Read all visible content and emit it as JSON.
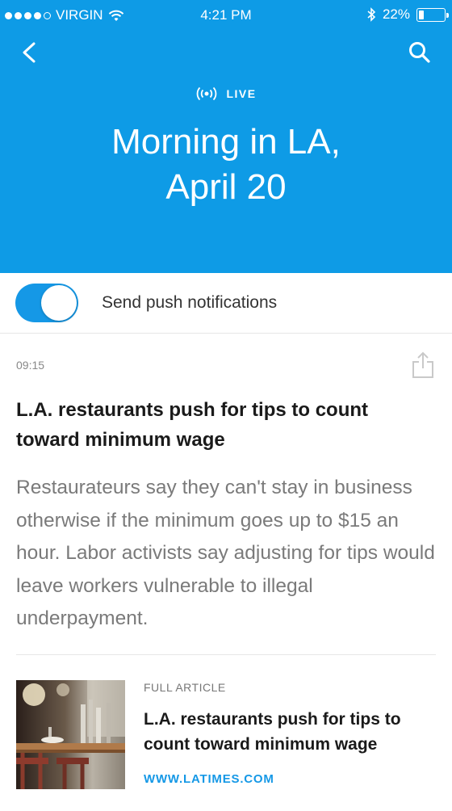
{
  "status_bar": {
    "carrier": "VIRGIN",
    "time": "4:21 PM",
    "battery_text": "22%",
    "battery_level": 0.22,
    "signal_bars_filled": 4,
    "signal_bars_total": 5
  },
  "header": {
    "background_color": "#0e9be6",
    "live_label": "LIVE",
    "title_line1": "Morning in LA,",
    "title_line2": "April 20"
  },
  "notifications": {
    "label": "Send push notifications",
    "enabled": true,
    "accent_color": "#1598e6"
  },
  "post": {
    "time": "09:15",
    "headline": "L.A. restaurants push for tips to count toward minimum wage",
    "summary": "Restaurateurs say they can't stay in business otherwise if the minimum goes up to $15 an hour. Labor activists say adjusting for tips would leave workers vulnerable to illegal underpayment."
  },
  "card": {
    "kicker": "FULL ARTICLE",
    "title": "L.A. restaurants push for tips to count toward minimum wage",
    "source": "WWW.LATIMES.COM"
  }
}
